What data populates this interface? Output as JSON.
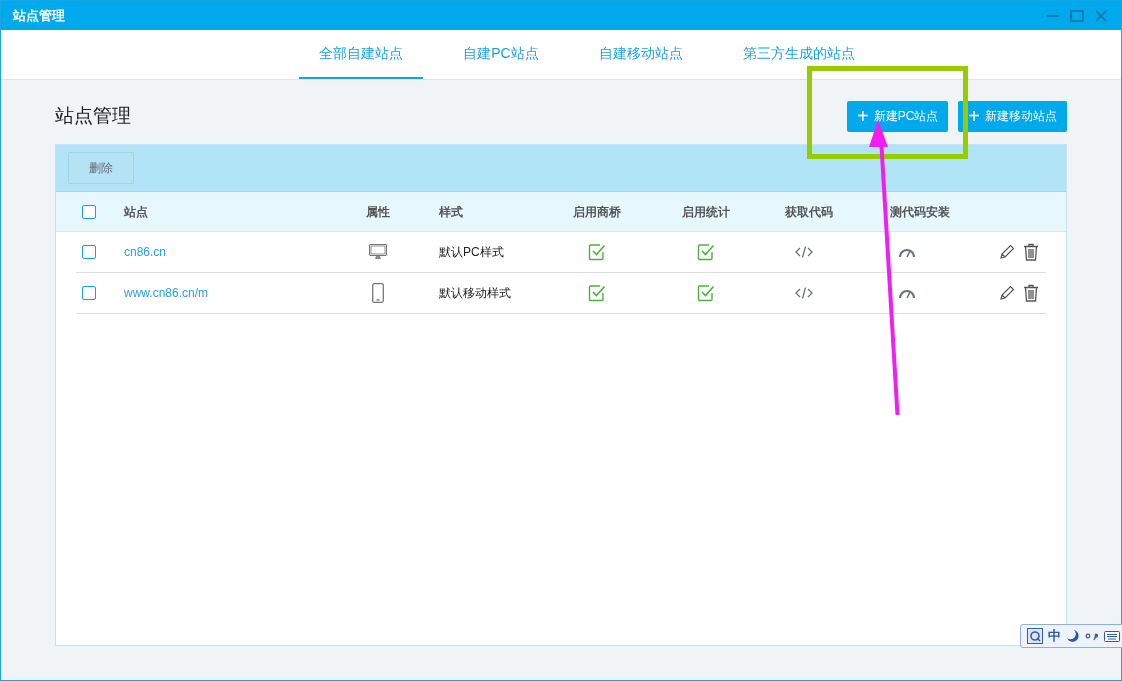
{
  "window": {
    "title": "站点管理"
  },
  "tabs": [
    {
      "label": "全部自建站点",
      "selected": true
    },
    {
      "label": "自建PC站点",
      "selected": false
    },
    {
      "label": "自建移动站点",
      "selected": false
    },
    {
      "label": "第三方生成的站点",
      "selected": false
    }
  ],
  "page": {
    "heading": "站点管理",
    "buttons": [
      {
        "icon": "+",
        "label": "新建PC站点"
      },
      {
        "icon": "+",
        "label": "新建移动站点"
      }
    ]
  },
  "table": {
    "toolbar": {
      "delete_button": "删除"
    },
    "select_all": {
      "checked": false
    },
    "columns": [
      "站点",
      "属性",
      "样式",
      "启用商桥",
      "启用统计",
      "获取代码",
      "测代码安装"
    ],
    "rows": [
      {
        "checked": false,
        "site": "cn86.cn",
        "kind": "pc",
        "style": "默认PC样式",
        "shangqiao_enabled": true,
        "stats_enabled": true
      },
      {
        "checked": false,
        "site": "www.cn86.cn/m",
        "kind": "mobile",
        "style": "默认移动样式",
        "shangqiao_enabled": true,
        "stats_enabled": true
      }
    ]
  },
  "ime_bar": {
    "mode": "中"
  }
}
